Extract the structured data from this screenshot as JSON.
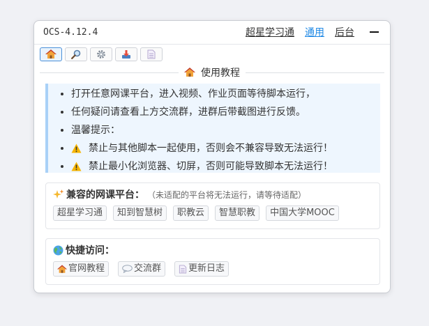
{
  "header": {
    "version": "OCS-4.12.4",
    "nav": [
      "超星学习通",
      "通用",
      "后台"
    ],
    "active_nav": "通用"
  },
  "toolbar": {
    "icons": [
      "home-icon",
      "search-icon",
      "gear-icon",
      "download-icon",
      "document-icon"
    ]
  },
  "section": {
    "icon": "home-icon",
    "title": "使用教程"
  },
  "tutorial": {
    "items": [
      "打开任意网课平台，进入视频、作业页面等待脚本运行，",
      "任何疑问请查看上方交流群，进群后带截图进行反馈。",
      "温馨提示：",
      "禁止与其他脚本一起使用，否则会不兼容导致无法运行！",
      "禁止最小化浏览器、切屏，否则可能导致脚本无法运行！"
    ],
    "warn_icon": "warning-icon"
  },
  "platforms": {
    "icon": "sparkles-icon",
    "title": "兼容的网课平台：",
    "note": "（未适配的平台将无法运行，请等待适配）",
    "items": [
      "超星学习通",
      "知到智慧树",
      "职教云",
      "智慧职教",
      "中国大学MOOC"
    ]
  },
  "quick": {
    "icon": "globe-icon",
    "title": "快捷访问：",
    "links": [
      {
        "label": "官网教程",
        "icon": "home-icon"
      },
      {
        "label": "交流群",
        "icon": "speech-bubble-icon"
      },
      {
        "label": "更新日志",
        "icon": "document-icon"
      }
    ]
  },
  "colors": {
    "accent": "#1e88e5",
    "tutorial_bg": "#eef6fe",
    "tutorial_border": "#a9d1f7"
  }
}
